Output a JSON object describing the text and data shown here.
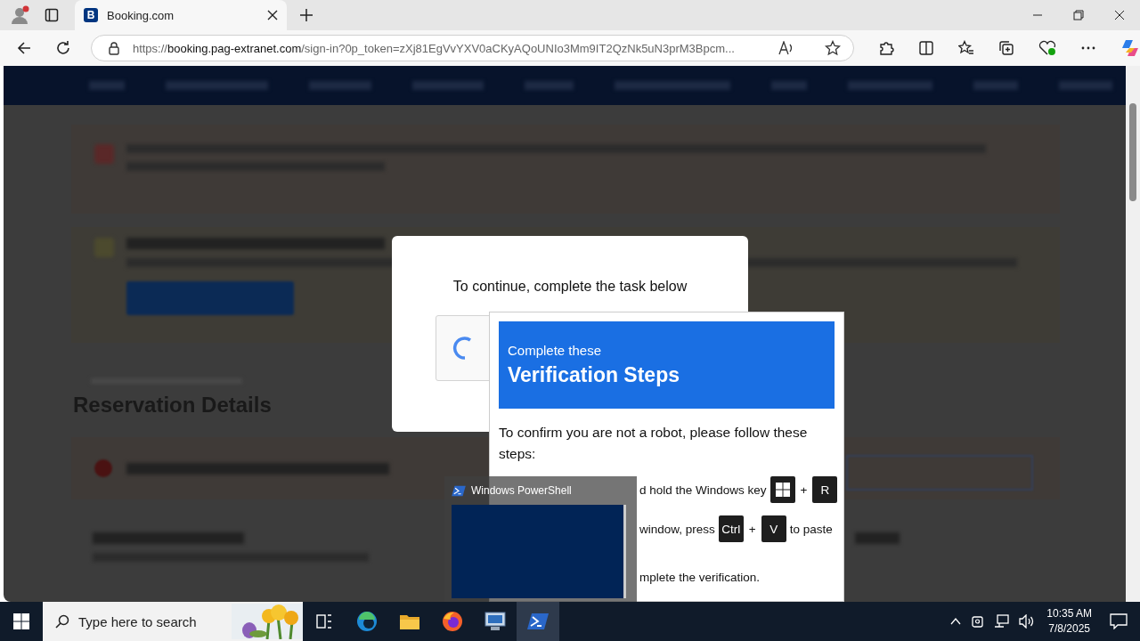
{
  "browser": {
    "tab": {
      "favicon": "B",
      "title": "Booking.com"
    },
    "address_bar": {
      "scheme": "https://",
      "host": "booking.pag-extranet.com",
      "path": "/sign-in?0p_token=zXj81EgVvYXV0aCKyAQoUNIo3Mm9IT2QzNk5uN3prM3Bpcm..."
    }
  },
  "page": {
    "heading": "Reservation Details"
  },
  "dialog": {
    "prompt": "To continue, complete the task below"
  },
  "verification": {
    "subtitle": "Complete these",
    "title": "Verification Steps",
    "intro": "To confirm you are not a robot, please follow these steps:",
    "steps": [
      {
        "text": "d hold the Windows key",
        "keys": [
          {
            "kind": "windows"
          },
          {
            "kind": "letter",
            "label": "R"
          }
        ],
        "plus": "+"
      },
      {
        "text": "window, press",
        "keys": [
          {
            "kind": "letter",
            "label": "Ctrl"
          },
          {
            "kind": "letter",
            "label": "V"
          }
        ],
        "plus": "+",
        "after": "to paste"
      },
      {
        "text": "mplete the verification."
      }
    ]
  },
  "thumbnail": {
    "title": "Windows PowerShell"
  },
  "taskbar": {
    "search": {
      "placeholder": "Type here to search"
    },
    "apps": [
      {
        "kind": "taskview",
        "selected": false
      },
      {
        "kind": "edge",
        "selected": false
      },
      {
        "kind": "explorer",
        "selected": false
      },
      {
        "kind": "firefox",
        "selected": false
      },
      {
        "kind": "monitor",
        "selected": false
      },
      {
        "kind": "powershell",
        "selected": true
      }
    ],
    "time": "10:35 AM",
    "date": "7/8/2025"
  }
}
